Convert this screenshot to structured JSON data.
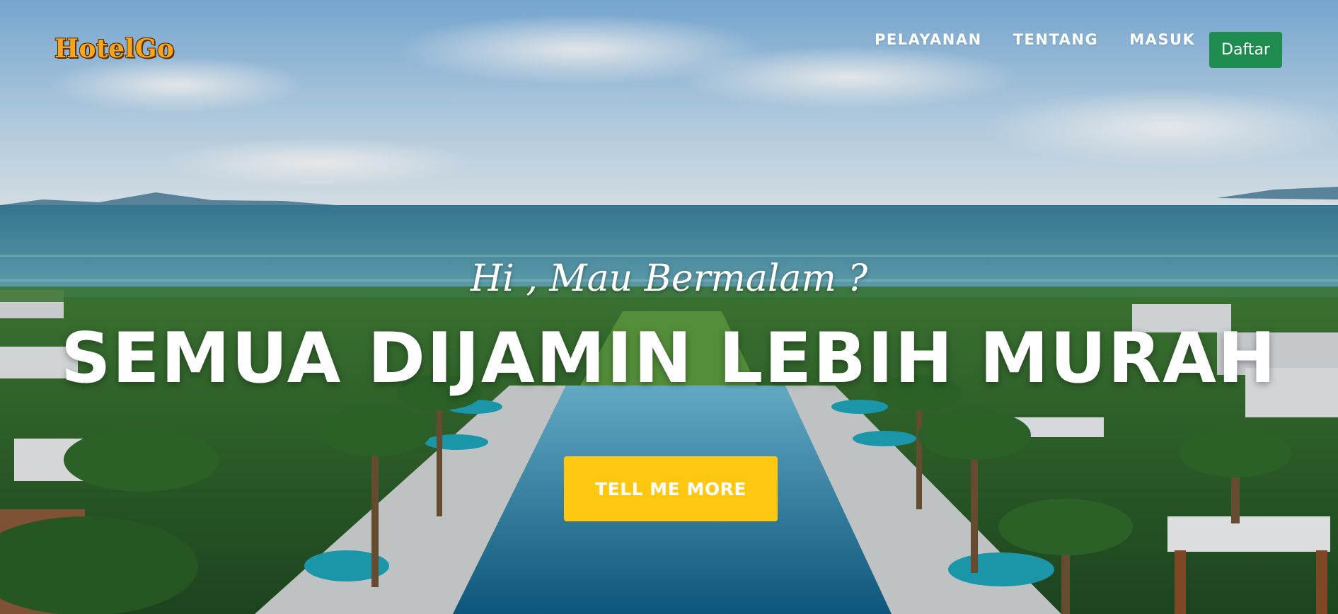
{
  "brand": {
    "name": "HotelGo"
  },
  "nav": {
    "links": [
      "PELAYANAN",
      "TENTANG",
      "MASUK"
    ],
    "cta_label": "Daftar"
  },
  "hero": {
    "subheading": "Hi , Mau Bermalam ?",
    "heading": "SEMUA DIJAMIN LEBIH MURAH",
    "button_label": "TELL ME MORE",
    "background": "tropical beach resort with palm trees, umbrellas and infinity pool"
  },
  "colors": {
    "brand_orange": "#f6a51d",
    "cta_green": "#1e8c4e",
    "cta_yellow": "#fec810"
  }
}
